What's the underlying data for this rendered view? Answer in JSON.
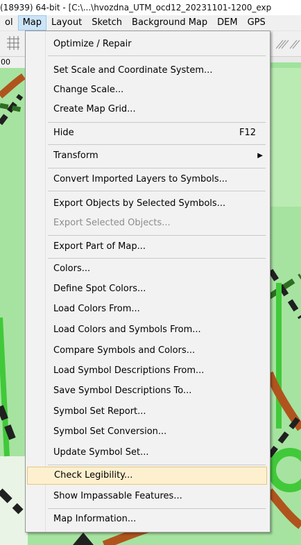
{
  "title_text": "(18939) 64-bit - [C:\\...\\hvozdna_UTM_ocd12_20231101-1200_exp",
  "menubar": {
    "items": [
      "ol",
      "Map",
      "Layout",
      "Sketch",
      "Background Map",
      "DEM",
      "GPS"
    ],
    "active": "Map"
  },
  "ruler_label": "00",
  "menu": {
    "items": [
      {
        "label": "Optimize / Repair"
      },
      {
        "label": "Set Scale and Coordinate System..."
      },
      {
        "label": "Change Scale..."
      },
      {
        "label": "Create Map Grid..."
      },
      {
        "label": "Hide",
        "shortcut": "F12"
      },
      {
        "label": "Transform",
        "submenu_icon": "triangle-right-icon"
      },
      {
        "label": "Convert Imported Layers to Symbols..."
      },
      {
        "label": "Export Objects by Selected Symbols..."
      },
      {
        "label": "Export Selected Objects...",
        "disabled": true
      },
      {
        "label": "Export Part of Map..."
      },
      {
        "label": "Colors..."
      },
      {
        "label": "Define Spot Colors..."
      },
      {
        "label": "Load Colors From..."
      },
      {
        "label": "Load Colors and Symbols From..."
      },
      {
        "label": "Compare Symbols and Colors..."
      },
      {
        "label": "Load Symbol Descriptions From..."
      },
      {
        "label": "Save Symbol Descriptions To..."
      },
      {
        "label": "Symbol Set Report..."
      },
      {
        "label": "Symbol Set Conversion..."
      },
      {
        "label": "Update Symbol Set..."
      },
      {
        "label": "Check Legibility...",
        "highlighted": true
      },
      {
        "label": "Show Impassable Features..."
      },
      {
        "label": "Map Information..."
      }
    ]
  },
  "colors": {
    "map_background": "#a6e3a0",
    "highlight": "#fdf0cf",
    "menubar_active": "#cce4f7"
  }
}
